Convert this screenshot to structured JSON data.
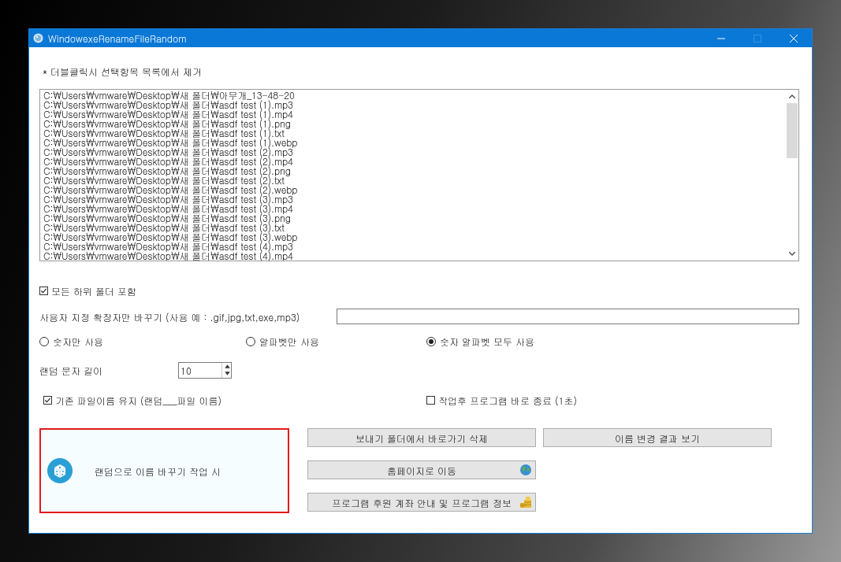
{
  "window": {
    "title": "WindowexeRenameFileRandom",
    "maximize_disabled": true
  },
  "hint": "* 더블클릭시 선택항목 목록에서 제거",
  "file_list": [
    "C:₩Users₩vmware₩Desktop₩새 폴더₩아무개_13-48-20",
    "C:₩Users₩vmware₩Desktop₩새 폴더₩asdf test (1).mp3",
    "C:₩Users₩vmware₩Desktop₩새 폴더₩asdf test (1).mp4",
    "C:₩Users₩vmware₩Desktop₩새 폴더₩asdf test (1).png",
    "C:₩Users₩vmware₩Desktop₩새 폴더₩asdf test (1).txt",
    "C:₩Users₩vmware₩Desktop₩새 폴더₩asdf test (1).webp",
    "C:₩Users₩vmware₩Desktop₩새 폴더₩asdf test (2).mp3",
    "C:₩Users₩vmware₩Desktop₩새 폴더₩asdf test (2).mp4",
    "C:₩Users₩vmware₩Desktop₩새 폴더₩asdf test (2).png",
    "C:₩Users₩vmware₩Desktop₩새 폴더₩asdf test (2).txt",
    "C:₩Users₩vmware₩Desktop₩새 폴더₩asdf test (2).webp",
    "C:₩Users₩vmware₩Desktop₩새 폴더₩asdf test (3).mp3",
    "C:₩Users₩vmware₩Desktop₩새 폴더₩asdf test (3).mp4",
    "C:₩Users₩vmware₩Desktop₩새 폴더₩asdf test (3).png",
    "C:₩Users₩vmware₩Desktop₩새 폴더₩asdf test (3).txt",
    "C:₩Users₩vmware₩Desktop₩새 폴더₩asdf test (3).webp",
    "C:₩Users₩vmware₩Desktop₩새 폴더₩asdf test (4).mp3",
    "C:₩Users₩vmware₩Desktop₩새 폴더₩asdf test (4).mp4"
  ],
  "include_subfolders": {
    "label": "모든 하위 폴더 포함",
    "checked": true
  },
  "extension_filter": {
    "label": "사용자 지정 확장자만 바꾸기 (사용 예 : .gif,jpg,txt,exe,mp3)"
  },
  "modes": [
    {
      "label": "숫자만 사용",
      "selected": false
    },
    {
      "label": "알파벳만 사용",
      "selected": false
    },
    {
      "label": "숫자 알파벳 모두 사용",
      "selected": true
    }
  ],
  "random_length": {
    "label": "랜덤 문자 길이",
    "value": "10"
  },
  "keep_name": {
    "label": "기존 파일이름 유지 (랜덤___파일 이름)",
    "checked": true
  },
  "exit_after": {
    "label": "작업후 프로그램 바로 종료 (1초)",
    "checked": false
  },
  "start_button": {
    "label": "랜덤으로 이름 바꾸기 작업 시"
  },
  "delete_shortcuts_button": {
    "label": "보내기 폴더에서 바로가기 삭제"
  },
  "view_results_button": {
    "label": "이름 변경 결과 보기"
  },
  "homepage_button": {
    "label": "홈페이지로 이동"
  },
  "about_button": {
    "label": "프로그램 후원 계좌 안내 및 프로그램 정보"
  }
}
